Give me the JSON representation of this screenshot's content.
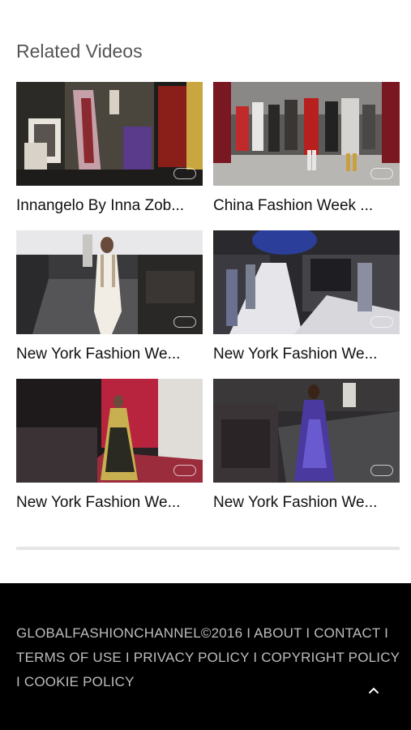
{
  "section": {
    "title": "Related Videos"
  },
  "videos": [
    {
      "title": "Innangelo By Inna Zob..."
    },
    {
      "title": "China Fashion Week ..."
    },
    {
      "title": "New York Fashion We..."
    },
    {
      "title": "New York Fashion We..."
    },
    {
      "title": "New York Fashion We..."
    },
    {
      "title": "New York Fashion We..."
    }
  ],
  "footer": {
    "copyright": "GLOBALFASHIONCHANNEL©2016",
    "about": "ABOUT",
    "contact": "CONTACT",
    "terms": "TERMS OF USE",
    "privacy": "PRIVACY POLICY",
    "copyright_policy": "COPYRIGHT POLICY",
    "cookie": "COOKIE POLICY",
    "separator": "I"
  },
  "icons": {
    "scroll_top": "chevron-up-icon"
  }
}
